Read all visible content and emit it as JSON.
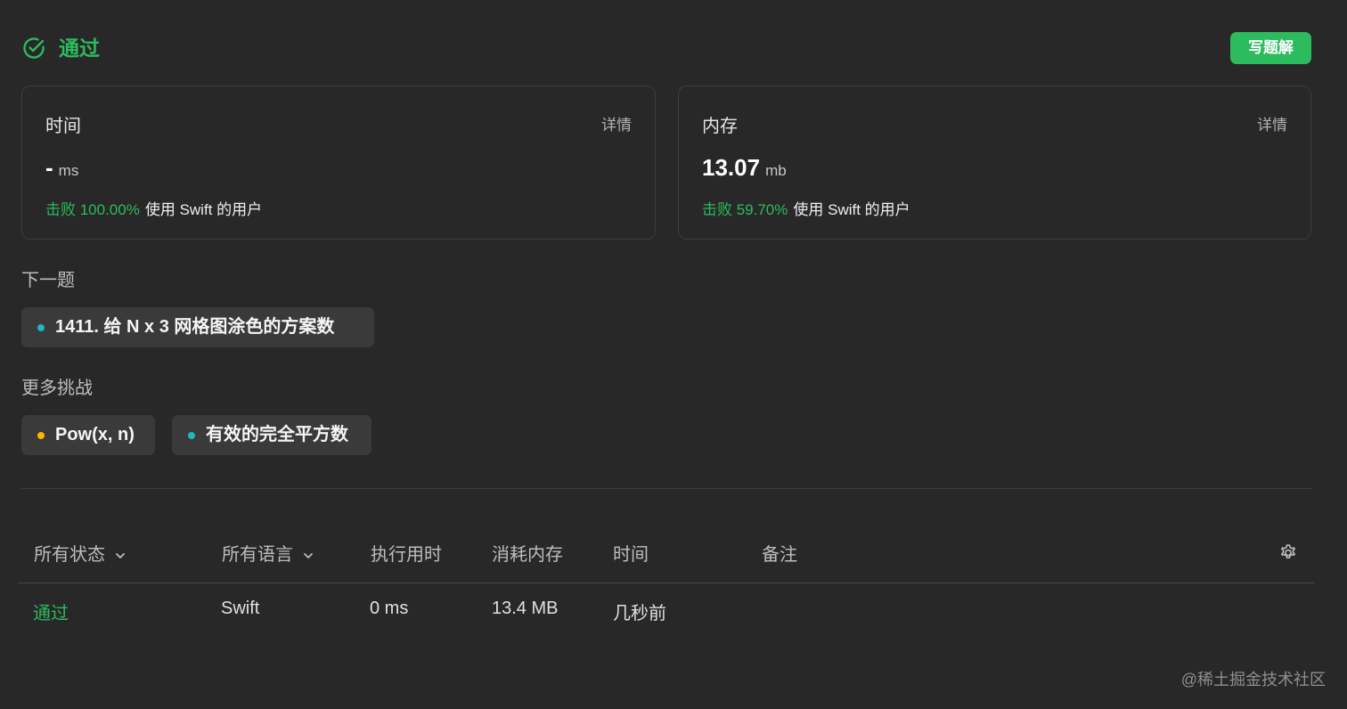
{
  "header": {
    "status": "通过",
    "status_icon": "check-circle-icon",
    "write_solution": "写题解",
    "accent": "#2cbb5d"
  },
  "time_card": {
    "label": "时间",
    "detail": "详情",
    "value": "-",
    "unit": "ms",
    "beat": "击败 100.00%",
    "beat_suffix": "使用 Swift 的用户"
  },
  "memory_card": {
    "label": "内存",
    "detail": "详情",
    "value": "13.07",
    "unit": "mb",
    "beat": "击败 59.70%",
    "beat_suffix": "使用 Swift 的用户"
  },
  "next_problem": {
    "title": "下一题",
    "item": {
      "label": "1411. 给 N x 3 网格图涂色的方案数",
      "dot_color": "#1cbaba"
    }
  },
  "more_challenges": {
    "title": "更多挑战",
    "items": [
      {
        "label": "Pow(x, n)",
        "dot_color": "#ffb800"
      },
      {
        "label": "有效的完全平方数",
        "dot_color": "#1cbaba"
      }
    ]
  },
  "table": {
    "headers": {
      "status": "所有状态",
      "language": "所有语言",
      "runtime": "执行用时",
      "memory": "消耗内存",
      "time": "时间",
      "notes": "备注"
    },
    "settings_icon": "gear-icon",
    "rows": [
      {
        "status": "通过",
        "language": "Swift",
        "runtime": "0 ms",
        "memory": "13.4 MB",
        "time": "几秒前"
      }
    ]
  },
  "watermark": "@稀土掘金技术社区"
}
